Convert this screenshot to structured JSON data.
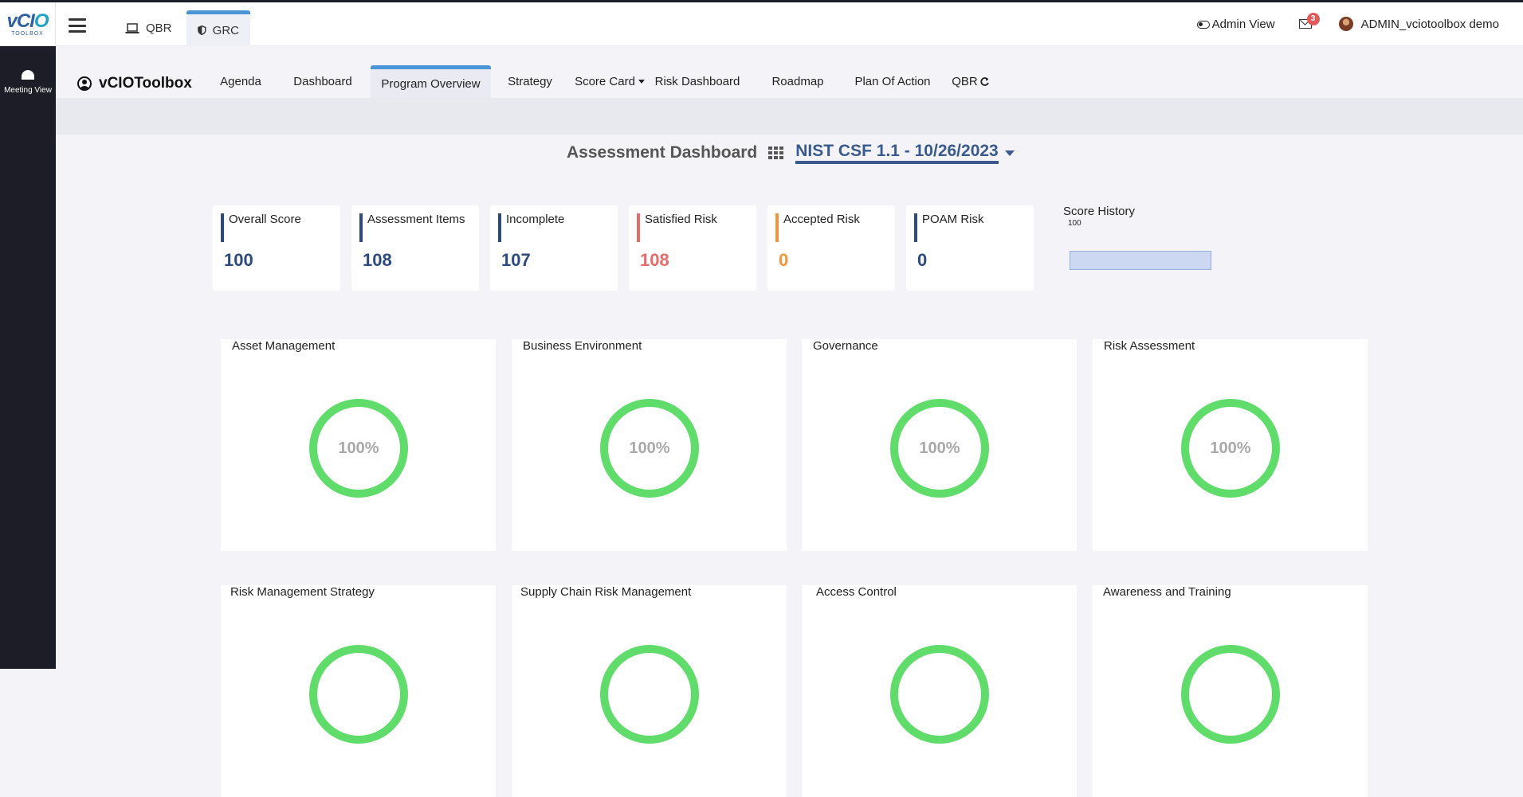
{
  "brand": {
    "logo_main": "vCIO",
    "logo_sub": "TOOLBOX"
  },
  "app_tabs": [
    {
      "label": "QBR",
      "icon": "laptop-icon"
    },
    {
      "label": "GRC",
      "icon": "shield-icon"
    }
  ],
  "topbar": {
    "admin_view": "Admin View",
    "notification_count": "3",
    "user_name": "ADMIN_vciotoolbox demo"
  },
  "sidebar": {
    "meeting_view": "Meeting View"
  },
  "org_name": "vCIOToolbox",
  "nav_tabs": [
    {
      "label": "Agenda"
    },
    {
      "label": "Dashboard"
    },
    {
      "label": "Program Overview",
      "active": true
    },
    {
      "label": "Strategy"
    },
    {
      "label": "Score Card",
      "dropdown": true
    },
    {
      "label": "Risk Dashboard"
    },
    {
      "label": "Roadmap"
    },
    {
      "label": "Plan Of Action"
    },
    {
      "label": "QBR",
      "icon": "refresh-icon"
    }
  ],
  "assessment": {
    "title": "Assessment Dashboard",
    "selected": "NIST CSF 1.1 - 10/26/2023"
  },
  "stats": [
    {
      "label": "Overall Score",
      "value": "100",
      "color": "#2c4a7e"
    },
    {
      "label": "Assessment Items",
      "value": "108",
      "color": "#2c4a7e"
    },
    {
      "label": "Incomplete",
      "value": "107",
      "color": "#2c4a7e"
    },
    {
      "label": "Satisfied Risk",
      "value": "108",
      "color": "#e86a6a"
    },
    {
      "label": "Accepted Risk",
      "value": "0",
      "color": "#f0953a"
    },
    {
      "label": "POAM Risk",
      "value": "0",
      "color": "#2c4a7e"
    }
  ],
  "score_history": {
    "title": "Score History",
    "tick": "100"
  },
  "categories": [
    {
      "title": "Asset Management",
      "percent": "100%"
    },
    {
      "title": "Business Environment",
      "percent": "100%"
    },
    {
      "title": "Governance",
      "percent": "100%"
    },
    {
      "title": "Risk Assessment",
      "percent": "100%"
    },
    {
      "title": "Risk Management Strategy",
      "percent": ""
    },
    {
      "title": "Supply Chain Risk Management",
      "percent": ""
    },
    {
      "title": "Access Control",
      "percent": ""
    },
    {
      "title": "Awareness and Training",
      "percent": ""
    }
  ],
  "colors": {
    "ring": "#5fdc6a",
    "accent": "#4a95d6",
    "sidebar": "#1c1d26"
  }
}
